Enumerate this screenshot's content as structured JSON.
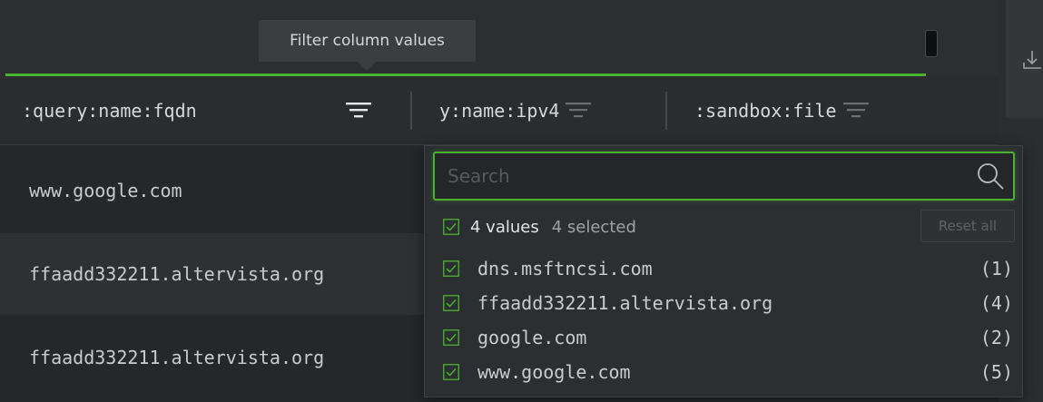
{
  "tooltip": {
    "text": "Filter column values"
  },
  "columns": [
    {
      "label": ":query:name:fqdn"
    },
    {
      "label": "y:name:ipv4"
    },
    {
      "label": ":sandbox:file"
    }
  ],
  "rows": [
    {
      "value": "www.google.com"
    },
    {
      "value": "ffaadd332211.altervista.org"
    },
    {
      "value": "ffaadd332211.altervista.org"
    }
  ],
  "filter_dropdown": {
    "search_placeholder": "Search",
    "summary": {
      "values": "4 values",
      "selected": "4 selected"
    },
    "reset_label": "Reset all",
    "items": [
      {
        "name": "dns.msftncsi.com",
        "count": "(1)"
      },
      {
        "name": "ffaadd332211.altervista.org",
        "count": "(4)"
      },
      {
        "name": "google.com",
        "count": "(2)"
      },
      {
        "name": "www.google.com",
        "count": "(5)"
      }
    ]
  },
  "colors": {
    "accent": "#4ab32e",
    "background": "#252729",
    "text": "#c9ccce"
  },
  "icons": [
    "filter-icon",
    "search-icon",
    "checkbox-checked-icon",
    "download-icon"
  ]
}
